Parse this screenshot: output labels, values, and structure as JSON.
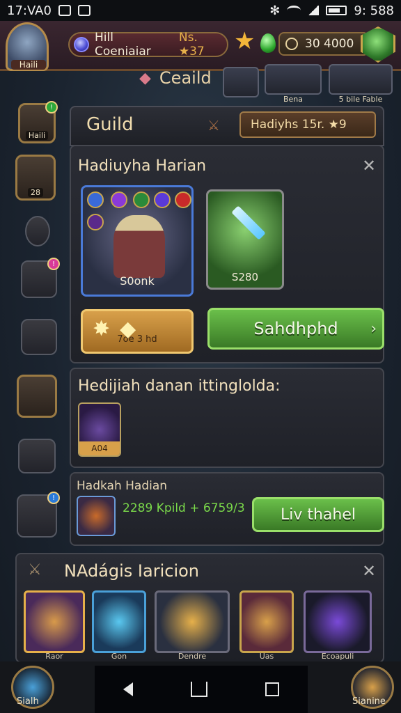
{
  "status_bar": {
    "time": "17:VA0",
    "right_time": "9: 588"
  },
  "hud": {
    "avatar_label": "Haili",
    "player_name": "Hill Coeniaiar",
    "player_tag": "Ns. ★37",
    "coins": "30 4000"
  },
  "subheader": {
    "title": "Ceaild",
    "tile_labels": [
      "Bena",
      "5 bile Fable"
    ]
  },
  "sidebar": {
    "labels": [
      "Haili",
      "28"
    ]
  },
  "guild": {
    "title": "Guild",
    "badge": "Hadiyhs 15r. ★9"
  },
  "panel1": {
    "title": "Hadiuyha Harian",
    "hero_card_label": "S0onk",
    "sword_card_label": "S280",
    "gold_button_label": "7oe 3 hd",
    "green_button_label": "Sahdhp⁠hd"
  },
  "panel2": {
    "title": "Hedijiah danan ittinglolda:",
    "item_label": "A04"
  },
  "panel3": {
    "title": "Hadkah Hadian",
    "reward_text": "2289 Kpild + 6759/3",
    "button_label": "Liv thahel"
  },
  "bottom_panel": {
    "title": "NAdágis Iaricion",
    "items": [
      {
        "label": "Raor"
      },
      {
        "label": "Gon"
      },
      {
        "label": "Dendre"
      },
      {
        "label": "Uas"
      },
      {
        "label": "Ecoapuli"
      }
    ]
  },
  "navbar": {
    "left_label": "Sialh",
    "right_label": "Sianine"
  },
  "colors": {
    "accent_gold": "#e6b04a",
    "accent_green": "#6abf4a",
    "panel_bg": "#2a2c34"
  }
}
